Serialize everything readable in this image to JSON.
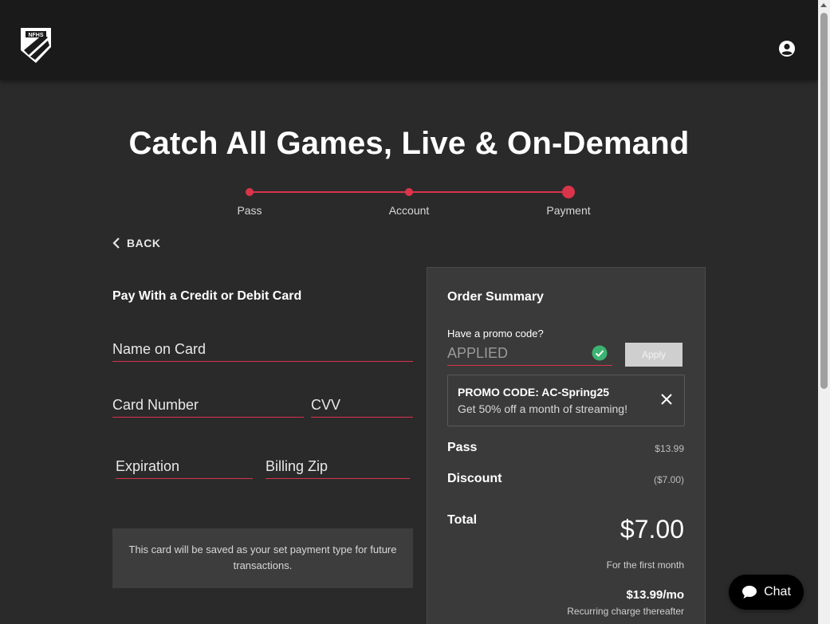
{
  "header": {
    "logo_text": "NFHS NETWORK",
    "account_icon": "user-circle-icon"
  },
  "page": {
    "title": "Catch All Games, Live & On-Demand"
  },
  "stepper": {
    "steps": [
      {
        "label": "Pass"
      },
      {
        "label": "Account"
      },
      {
        "label": "Payment",
        "active": true
      }
    ],
    "accent": "#d9344a"
  },
  "back": {
    "label": "BACK"
  },
  "payment_form": {
    "title": "Pay With a Credit or Debit Card",
    "name_on_card": {
      "placeholder": "Name on Card",
      "value": ""
    },
    "card_number": {
      "placeholder": "Card Number",
      "value": ""
    },
    "cvv": {
      "placeholder": "CVV",
      "value": ""
    },
    "expiration": {
      "placeholder": "Expiration",
      "value": ""
    },
    "billing_zip": {
      "placeholder": "Billing Zip",
      "value": ""
    },
    "note": "This card will be saved as your set payment type for future transactions."
  },
  "summary": {
    "title": "Order Summary",
    "promo_label": "Have a promo code?",
    "promo_value": "APPLIED",
    "apply_label": "Apply",
    "promo_card": {
      "code": "PROMO CODE: AC-Spring25",
      "description": "Get 50% off a month of streaming!"
    },
    "pass_label": "Pass",
    "pass_value": "$13.99",
    "discount_label": "Discount",
    "discount_value": "($7.00)",
    "total_label": "Total",
    "total_value": "$7.00",
    "first_month": "For the first month",
    "recurring_price": "$13.99/mo",
    "recurring_note": "Recurring charge thereafter"
  },
  "chat": {
    "label": "Chat"
  }
}
